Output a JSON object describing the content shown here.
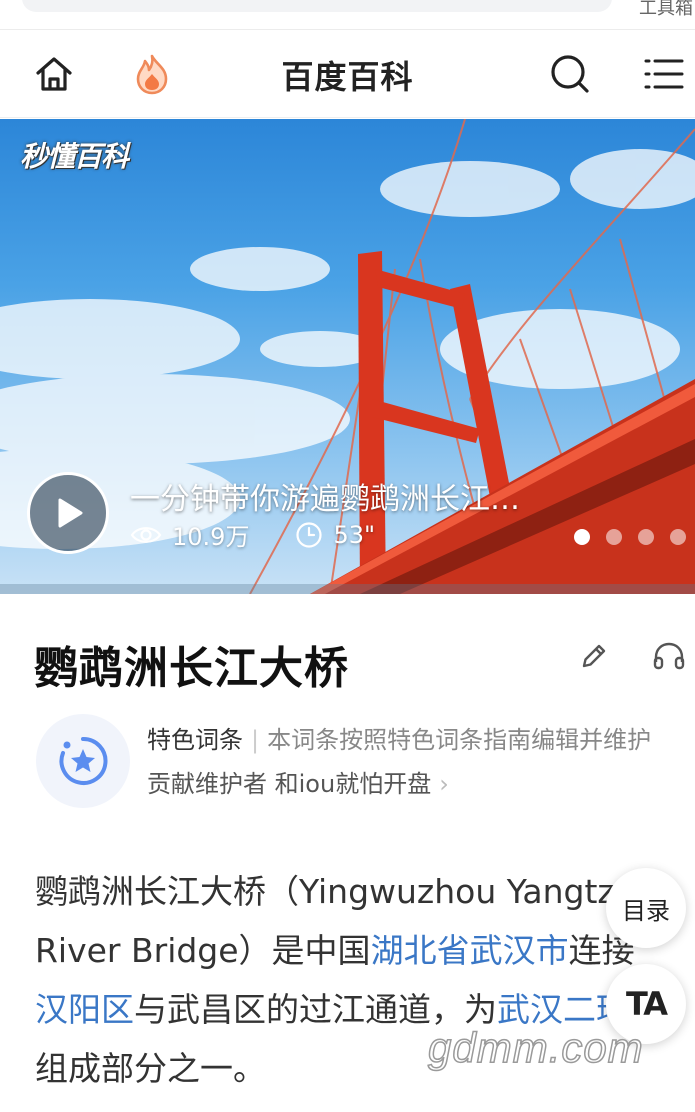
{
  "browser": {
    "tools_label": "工具箱"
  },
  "header": {
    "title": "百度百科",
    "icons": [
      "home-icon",
      "flame-icon",
      "search-icon",
      "menu-icon"
    ]
  },
  "hero": {
    "logo_text": "秒懂百科",
    "video_title": "一分钟带你游遍鹦鹉洲长江…",
    "views": "10.9万",
    "duration": "53\"",
    "carousel_count": 4,
    "carousel_active": 1
  },
  "article": {
    "title": "鹦鹉洲长江大桥",
    "feature_label": "特色词条",
    "feature_separator": "|",
    "feature_desc": "本词条按照特色词条指南编辑并维护",
    "contributors": "贡献维护者 和iou就怕开盘",
    "paragraph": {
      "t1": "鹦鹉洲长江大桥（Yingwuzhou Yangtze River Bridge）是中国",
      "link1": "湖北省武汉市",
      "t2": "连接",
      "link2": "汉阳区",
      "t3": "与武昌区的过江通道，为",
      "link3": "武汉二环线",
      "t4": "组成部分之一。"
    }
  },
  "floating": {
    "toc_label": "目录",
    "ta_label": "TA"
  },
  "watermark": "gdmm.com",
  "colors": {
    "link": "#3a77c6",
    "bridge": "#d9361f",
    "sky": "#2c86d8"
  }
}
